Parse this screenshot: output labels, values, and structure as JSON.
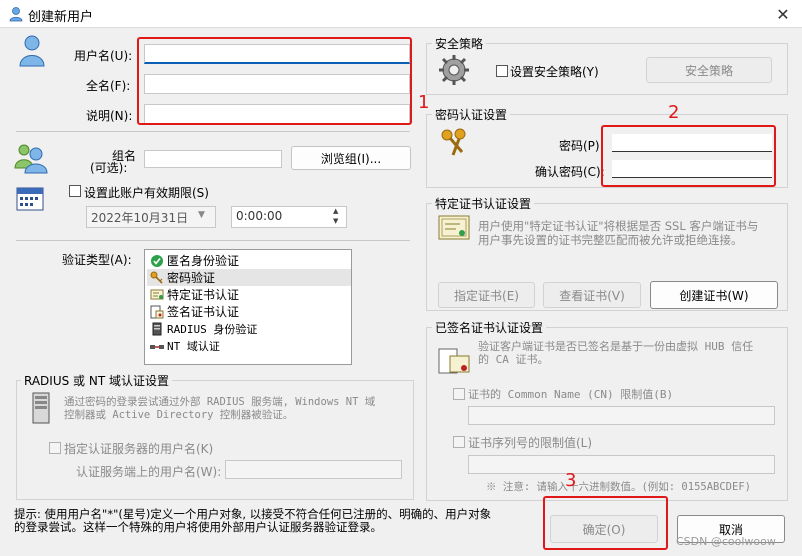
{
  "window": {
    "title": "创建新用户",
    "close_glyph": "✕"
  },
  "user": {
    "username_label": "用户名(U):",
    "fullname_label": "全名(F):",
    "description_label": "说明(N):",
    "username_value": "",
    "fullname_value": "",
    "description_value": ""
  },
  "group": {
    "label_line1": "组名",
    "label_line2": "(可选):",
    "value": "",
    "browse_button": "浏览组(I)..."
  },
  "expiry": {
    "checkbox_label": "设置此账户有效期限(S)",
    "date_value": "2022年10月31日",
    "time_value": "0:00:00"
  },
  "auth": {
    "label": "验证类型(A):",
    "items": [
      {
        "label": "匿名身份验证",
        "icon": "green-check-icon",
        "selected": false
      },
      {
        "label": "密码验证",
        "icon": "keys-icon",
        "selected": true
      },
      {
        "label": "特定证书认证",
        "icon": "certificate-icon",
        "selected": false
      },
      {
        "label": "签名证书认证",
        "icon": "signed-certificate-icon",
        "selected": false
      },
      {
        "label": "RADIUS 身份验证",
        "icon": "server-icon",
        "selected": false
      },
      {
        "label": "NT 域认证",
        "icon": "network-icon",
        "selected": false
      }
    ]
  },
  "radius": {
    "title": "RADIUS 或 NT 域认证设置",
    "description_line1": "通过密码的登录尝试通过外部 RADIUS 服务端, Windows NT 域",
    "description_line2": "控制器或 Active Directory 控制器被验证。",
    "checkbox_label": "指定认证服务器的用户名(K)",
    "server_username_label": "认证服务端上的用户名(W):",
    "server_username_value": ""
  },
  "hint": {
    "line1": "提示: 使用用户名\"*\"(星号)定义一个用户对象, 以接受不符合任何已注册的、明确的、用户对象",
    "line2": "的登录尝试。这样一个特殊的用户将使用外部用户认证服务器验证登录。"
  },
  "security_policy": {
    "title": "安全策略",
    "checkbox_label": "设置安全策略(Y)",
    "button": "安全策略"
  },
  "password": {
    "title": "密码认证设置",
    "password_label": "密码(P):",
    "confirm_label": "确认密码(C):",
    "password_value": "",
    "confirm_value": ""
  },
  "specific_cert": {
    "title": "特定证书认证设置",
    "description_line1": "用户使用\"特定证书认证\"将根据是否 SSL 客户端证书与",
    "description_line2": "用户事先设置的证书完整匹配而被允许或拒绝连接。",
    "specify_button": "指定证书(E)",
    "view_button": "查看证书(V)",
    "create_button": "创建证书(W)"
  },
  "signed_cert": {
    "title": "已签名证书认证设置",
    "description_line1": "验证客户端证书是否已签名是基于一份由虚拟 HUB 信任",
    "description_line2": "的 CA 证书。",
    "cn_checkbox_label": "证书的 Common Name (CN) 限制值(B)",
    "cn_value": "",
    "serial_checkbox_label": "证书序列号的限制值(L)",
    "serial_value": "",
    "note": "※ 注意: 请输入十六进制数值。(例如: 0155ABCDEF)"
  },
  "footer": {
    "ok_button": "确定(O)",
    "cancel_button": "取消"
  },
  "annotations": {
    "marker1": "1",
    "marker2": "2",
    "marker3": "3",
    "color": "#e01818"
  },
  "watermark": "CSDN @coolwoow"
}
